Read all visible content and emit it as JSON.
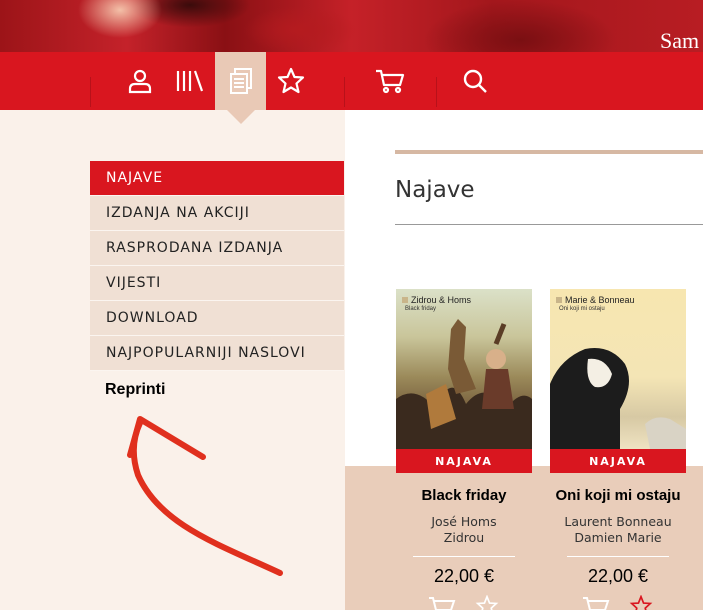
{
  "header": {
    "banner_text": "Sam"
  },
  "nav": {
    "items": [
      {
        "icon": "user-icon",
        "active": false
      },
      {
        "icon": "library-icon",
        "active": false
      },
      {
        "icon": "documents-icon",
        "active": true
      },
      {
        "icon": "star-icon",
        "active": false
      },
      {
        "icon": "cart-icon",
        "active": false
      },
      {
        "icon": "search-icon",
        "active": false
      }
    ]
  },
  "sidebar": {
    "items": [
      {
        "label": "NAJAVE",
        "active": true
      },
      {
        "label": "IZDANJA NA AKCIJI",
        "active": false
      },
      {
        "label": "RASPRODANA IZDANJA",
        "active": false
      },
      {
        "label": "VIJESTI",
        "active": false
      },
      {
        "label": "DOWNLOAD",
        "active": false
      },
      {
        "label": "NAJPOPULARNIJI NASLOVI",
        "active": false
      }
    ],
    "annotation": "Reprinti"
  },
  "main": {
    "title": "Najave",
    "books": [
      {
        "cover_author": "Zidrou & Homs",
        "cover_subtitle": "Black friday",
        "badge": "NAJAVA",
        "title": "Black friday",
        "authors": [
          "José Homs",
          "Zidrou"
        ],
        "price": "22,00 €"
      },
      {
        "cover_author": "Marie & Bonneau",
        "cover_subtitle": "Oni koji mi ostaju",
        "badge": "NAJAVA",
        "title": "Oni koji mi ostaju",
        "authors": [
          "Laurent Bonneau",
          "Damien Marie"
        ],
        "price": "22,00 €"
      }
    ]
  },
  "colors": {
    "brand_red": "#d9161f",
    "accent_beige": "#e9c9b6",
    "sidebar_bg": "#faf1ea"
  }
}
